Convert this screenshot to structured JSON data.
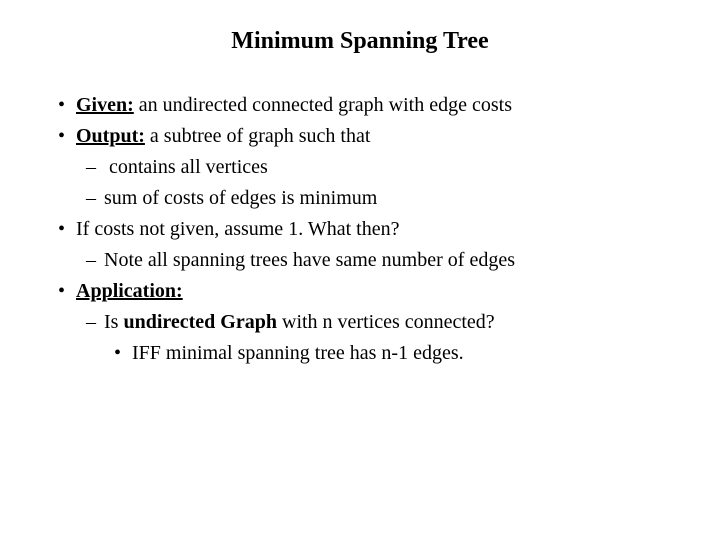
{
  "title": "Minimum Spanning Tree",
  "b1_bold": "Given:",
  "b1_rest": " an undirected connected graph with edge costs",
  "b2_bold": "Output:",
  "b2_rest": " a subtree of graph such that",
  "b2_s1": " contains all vertices",
  "b2_s2": "sum of costs of edges is minimum",
  "b3": "If costs not given, assume 1. What then?",
  "b3_s1": "Note all spanning trees have same number of edges",
  "b4_bold": "Application:",
  "b4_s1_a": "Is ",
  "b4_s1_bold": "undirected Graph",
  "b4_s1_b": " with n vertices connected?",
  "b4_s1_s1": "IFF minimal spanning tree has n-1 edges."
}
